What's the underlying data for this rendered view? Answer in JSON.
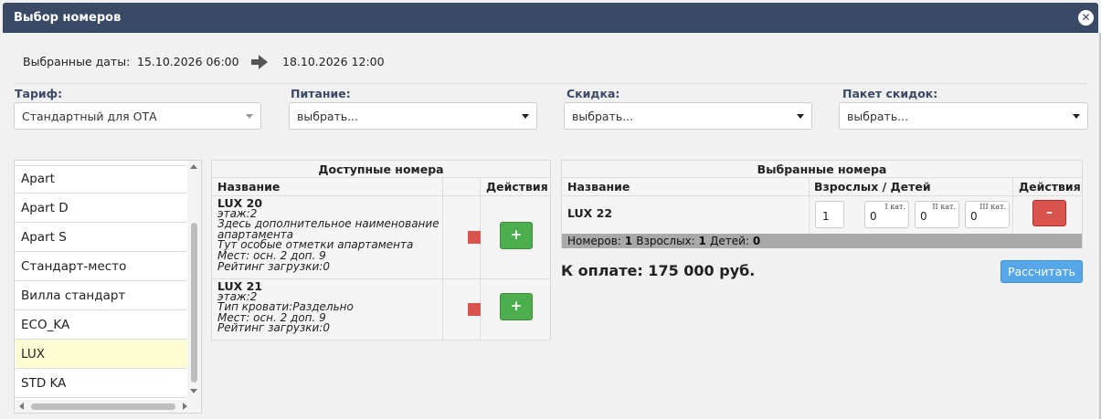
{
  "window": {
    "title": "Выбор номеров",
    "close_symbol": "✕"
  },
  "dates": {
    "label": "Выбранные даты:",
    "from": "15.10.2026 06:00",
    "to": "18.10.2026 12:00"
  },
  "filters": [
    {
      "label": "Тариф:",
      "value": "Стандартный для ОТА"
    },
    {
      "label": "Питание:",
      "value": "выбрать..."
    },
    {
      "label": "Скидка:",
      "value": "выбрать..."
    },
    {
      "label": "Пакет скидок:",
      "value": "выбрать..."
    }
  ],
  "room_types": [
    "Apart",
    "Apart D",
    "Apart S",
    "Стандарт-место",
    "Вилла стандарт",
    "ECO_KA",
    "LUX",
    "STD KA"
  ],
  "room_types_active": "LUX",
  "available": {
    "caption": "Доступные номера",
    "col_name": "Название",
    "col_actions": "Действия",
    "add_label": "+",
    "rooms": [
      {
        "name": "LUX 20",
        "lines": [
          "этаж:2",
          "Здесь дополнительное наименование",
          "апартамента",
          "Тут особые отметки апартамента",
          "Мест: осн. 2 доп. 9",
          "Рейтинг загрузки:0"
        ]
      },
      {
        "name": "LUX 21",
        "lines": [
          "этаж:2",
          "Тип кровати:Раздельно",
          "Мест: осн. 2 доп. 9",
          "Рейтинг загрузки:0"
        ]
      }
    ]
  },
  "selected": {
    "caption": "Выбранные номера",
    "col_name": "Название",
    "col_guests": "Взрослых / Детей",
    "col_actions": "Действия",
    "remove_label": "–",
    "row": {
      "name": "LUX 22",
      "adults": "1",
      "children": [
        {
          "cat": "I кат.",
          "value": "0"
        },
        {
          "cat": "II кат.",
          "value": "0"
        },
        {
          "cat": "III кат.",
          "value": "0"
        }
      ]
    },
    "summary": {
      "rooms_label": "Номеров:",
      "rooms": "1",
      "adults_label": "Взрослых:",
      "adults": "1",
      "children_label": "Детей:",
      "children": "0"
    }
  },
  "total": "К оплате: 175 000 руб.",
  "calc_button": "Рассчитать",
  "colors": {
    "titlebar": "#3a4a66",
    "add": "#4cae4c",
    "remove": "#d9534f",
    "calc": "#56a6e8",
    "active_row": "#fdfdd4"
  }
}
